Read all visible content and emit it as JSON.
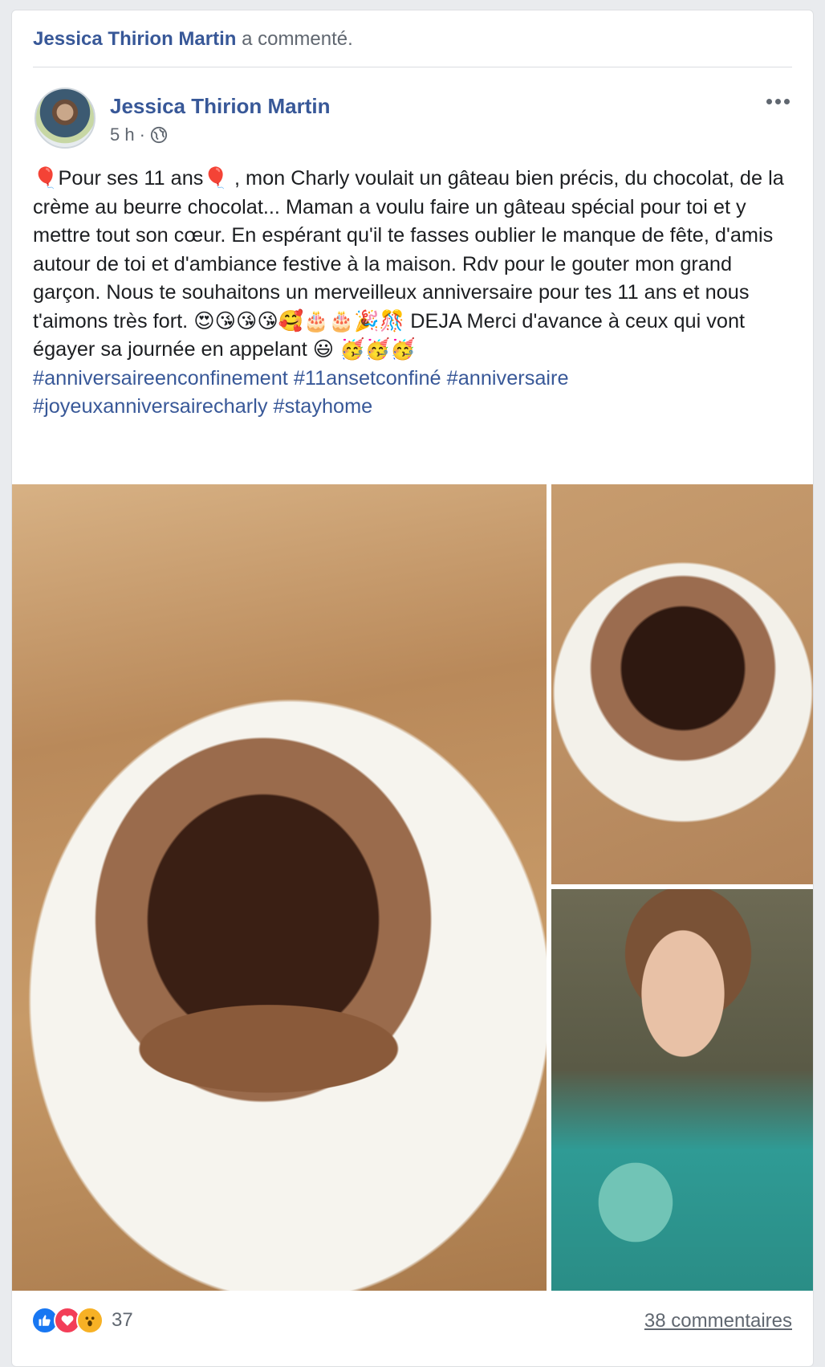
{
  "activity": {
    "actor": "Jessica Thirion Martin",
    "action": "a commenté."
  },
  "post": {
    "author": "Jessica Thirion Martin",
    "time": "5 h",
    "separator": "·",
    "text": "🎈Pour ses 11 ans🎈 , mon Charly voulait un gâteau bien précis, du chocolat, de la crème au beurre chocolat... Maman a voulu faire un gâteau spécial pour toi et y mettre tout son cœur. En espérant qu'il te fasses oublier le manque de fête, d'amis autour de toi et d'ambiance festive à la maison. Rdv pour le gouter mon grand garçon. Nous te souhaitons un merveilleux anniversaire pour tes 11 ans et nous t'aimons très fort. 😍😘😘😘🥰🎂🎂🎉🎊 DEJA Merci d'avance à ceux qui vont égayer sa journée en appelant 😃 🥳🥳🥳",
    "hashtags": "#anniversaireenconfinement #11ansetconfiné #anniversaire #joyeuxanniversairecharly #stayhome",
    "icons": {
      "privacy": "globe-icon",
      "menu": "more-icon"
    }
  },
  "footer": {
    "reaction_count": "37",
    "comments_label": "38 commentaires",
    "reaction_icons": [
      "like-icon",
      "love-icon",
      "wow-icon"
    ],
    "colors": {
      "like": "#1877f2",
      "love": "#f33e58",
      "wow": "#f7b125"
    }
  },
  "colors": {
    "link": "#385898",
    "muted": "#606770"
  }
}
